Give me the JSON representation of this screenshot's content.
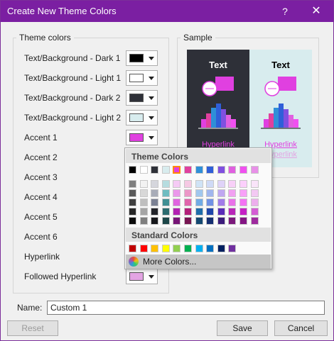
{
  "window": {
    "title": "Create New Theme Colors",
    "help": "?",
    "close": "✕"
  },
  "theme_colors": {
    "legend": "Theme colors",
    "rows": [
      {
        "label": "Text/Background - Dark 1",
        "color": "#000000"
      },
      {
        "label": "Text/Background - Light 1",
        "color": "#ffffff"
      },
      {
        "label": "Text/Background - Dark 2",
        "color": "#2e3038"
      },
      {
        "label": "Text/Background - Light 2",
        "color": "#d8ecee"
      },
      {
        "label": "Accent 1",
        "color": "#e040e0"
      },
      {
        "label": "Accent 2",
        "color": ""
      },
      {
        "label": "Accent 3",
        "color": ""
      },
      {
        "label": "Accent 4",
        "color": ""
      },
      {
        "label": "Accent 5",
        "color": ""
      },
      {
        "label": "Accent 6",
        "color": ""
      },
      {
        "label": "Hyperlink",
        "color": ""
      },
      {
        "label": "Followed Hyperlink",
        "color": "#e3a4e3"
      }
    ]
  },
  "sample": {
    "legend": "Sample",
    "text_label": "Text",
    "hyperlink": "Hyperlink",
    "followed_hyperlink": "Hyperlink"
  },
  "dropdown": {
    "theme_header": "Theme Colors",
    "standard_header": "Standard Colors",
    "more_colors": "More Colors...",
    "theme_top": [
      "#000000",
      "#ffffff",
      "#2e3038",
      "#d8ecee",
      "#e040e0",
      "#e0409e",
      "#2f8fd8",
      "#2f5fd8",
      "#8050e0",
      "#e060e0",
      "#f050f0",
      "#e890e8"
    ],
    "theme_shades": [
      [
        "#7f7f7f",
        "#f2f2f2",
        "#d5d6dc",
        "#b6dcdf",
        "#f5caf5",
        "#f5c9e3",
        "#cfe3f6",
        "#cfdaf6",
        "#dfd3f8",
        "#f8d0f8",
        "#fcd0fc",
        "#f9e4f9"
      ],
      [
        "#595959",
        "#d8d8d8",
        "#a8acb8",
        "#6fbcc1",
        "#eb97eb",
        "#ec97c7",
        "#a0c7ee",
        "#a0b6ee",
        "#c0a8f1",
        "#f1a1f1",
        "#f8a1f8",
        "#f3c9f3"
      ],
      [
        "#3f3f3f",
        "#bfbfbf",
        "#7b8194",
        "#3f8f94",
        "#e064e0",
        "#e064ab",
        "#71abe5",
        "#7192e5",
        "#a17ce9",
        "#e972e9",
        "#f472f4",
        "#edaeed"
      ],
      [
        "#262626",
        "#a5a5a5",
        "#22242a",
        "#2b6b6f",
        "#b320b3",
        "#b3207a",
        "#1f6daa",
        "#1f46aa",
        "#5a2cb8",
        "#b826b8",
        "#c520c5",
        "#d45ed4"
      ],
      [
        "#0c0c0c",
        "#7f7f7f",
        "#17181c",
        "#1d4749",
        "#771577",
        "#771552",
        "#154971",
        "#152f71",
        "#3c1d7b",
        "#7b197b",
        "#831583",
        "#9e2b9e"
      ]
    ],
    "standard": [
      "#c00000",
      "#ff0000",
      "#ffc000",
      "#ffff00",
      "#92d050",
      "#00b050",
      "#00b0f0",
      "#0070c0",
      "#002060",
      "#7030a0"
    ]
  },
  "name": {
    "label": "Name:",
    "value": "Custom 1"
  },
  "buttons": {
    "reset": "Reset",
    "save": "Save",
    "cancel": "Cancel"
  }
}
